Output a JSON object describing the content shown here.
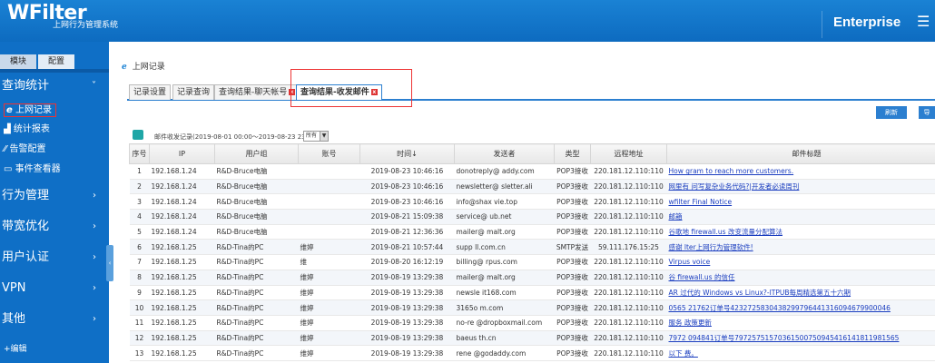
{
  "header": {
    "logo": "WFilter",
    "subtitle": "上网行为管理系统",
    "edition": "Enterprise",
    "menu_icon": "hamburger-icon"
  },
  "sidebar": {
    "tabs": [
      "模块",
      "配置"
    ],
    "groups": [
      {
        "label": "查询统计",
        "chevron": "˅"
      },
      {
        "label": "行为管理",
        "chevron": "›"
      },
      {
        "label": "带宽优化",
        "chevron": "›"
      },
      {
        "label": "用户认证",
        "chevron": "›"
      },
      {
        "label": "VPN",
        "chevron": "›"
      },
      {
        "label": "其他",
        "chevron": "›"
      }
    ],
    "sub_items": [
      "上网记录",
      "统计报表",
      "告警配置",
      "事件查看器"
    ],
    "bottom": "+编辑"
  },
  "breadcrumb": "上网记录",
  "tabs": [
    {
      "label": "记录设置"
    },
    {
      "label": "记录查询"
    },
    {
      "label": "查询结果-聊天帐号"
    },
    {
      "label": "查询结果-收发邮件"
    }
  ],
  "buttons": {
    "refresh": "刷新",
    "export": "导"
  },
  "filter": {
    "text": "邮件收发记录(2019-08-01 00:00～2019-08-23 23:59)",
    "select_value": "所有"
  },
  "table": {
    "headers": [
      "序号",
      "IP",
      "用户组",
      "账号",
      "时间↓",
      "发送者",
      "类型",
      "远程地址",
      "邮件标题"
    ],
    "rows": [
      [
        "1",
        "192.168.1.24",
        "R&D-Bruce电脑",
        "",
        "2019-08-23 10:46:16",
        "donotreply@  addy.com",
        "POP3接收",
        "220.181.12.110:110",
        "How     gram  to  reach  more  customers."
      ],
      [
        "2",
        "192.168.1.24",
        "R&D-Bruce电脑",
        "",
        "2019-08-23 10:46:16",
        "newsletter@  sletter.ali",
        "POP3接收",
        "220.181.12.110:110",
        "网里有   问写复杂业务代码?|开发者必读周刊"
      ],
      [
        "3",
        "192.168.1.24",
        "R&D-Bruce电脑",
        "",
        "2019-08-23 10:46:16",
        "info@shax  vie.top",
        "POP3接收",
        "220.181.12.110:110",
        "wfilter   Final  Notice"
      ],
      [
        "4",
        "192.168.1.24",
        "R&D-Bruce电脑",
        "",
        "2019-08-21 15:09:38",
        "service@  ub.net",
        "POP3接收",
        "220.181.12.110:110",
        "邮箱"
      ],
      [
        "5",
        "192.168.1.24",
        "R&D-Bruce电脑",
        "",
        "2019-08-21 12:36:36",
        "mailer@  malt.org",
        "POP3接收",
        "220.181.12.110:110",
        "谷歌地   firewall.us  改变流量分配算法"
      ],
      [
        "6",
        "192.168.1.25",
        "R&D-Tina的PC",
        "维婷",
        "2019-08-21 10:57:44",
        "supp  ll.com.cn",
        "SMTP发送",
        "59.111.176.15:25",
        "感谢   lter上网行为管理软件!"
      ],
      [
        "7",
        "192.168.1.25",
        "R&D-Tina的PC",
        "维",
        "2019-08-20 16:12:19",
        "billing@  rpus.com",
        "POP3接收",
        "220.181.12.110:110",
        "Virpus    voice"
      ],
      [
        "8",
        "192.168.1.25",
        "R&D-Tina的PC",
        "维婷",
        "2019-08-19 13:29:38",
        "mailer@  malt.org",
        "POP3接收",
        "220.181.12.110:110",
        "谷   firewall.us  的信任"
      ],
      [
        "9",
        "192.168.1.25",
        "R&D-Tina的PC",
        "维婷",
        "2019-08-19 13:29:38",
        "newsle  it168.com",
        "POP3接收",
        "220.181.12.110:110",
        "AR   过代的  Windows  vs  Linux?-ITPUB每周精选第五十六期"
      ],
      [
        "10",
        "192.168.1.25",
        "R&D-Tina的PC",
        "维婷",
        "2019-08-19 13:29:38",
        "3165o  m.com",
        "POP3接收",
        "220.181.12.110:110",
        "0565   21762订单号4232725830438299796441316094679900046"
      ],
      [
        "11",
        "192.168.1.25",
        "R&D-Tina的PC",
        "维婷",
        "2019-08-19 13:29:38",
        "no-re  @dropboxmail.com",
        "POP3接收",
        "220.181.12.110:110",
        "服务   政策更新"
      ],
      [
        "12",
        "192.168.1.25",
        "R&D-Tina的PC",
        "维婷",
        "2019-08-19 13:29:38",
        "baeus  th.cn",
        "POP3接收",
        "220.181.12.110:110",
        "7972   094841订单号79725751570361500750945416141811981565"
      ],
      [
        "13",
        "192.168.1.25",
        "R&D-Tina的PC",
        "维婷",
        "2019-08-19 13:29:38",
        "rene  @godaddy.com",
        "POP3接收",
        "220.181.12.110:110",
        "以下   费。"
      ]
    ]
  }
}
